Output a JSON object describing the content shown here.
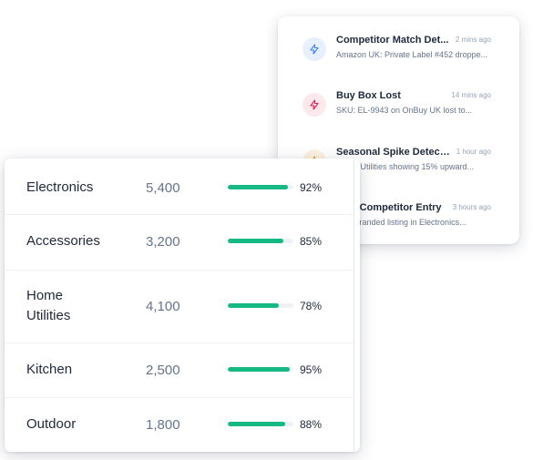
{
  "notifications": [
    {
      "title": "Competitor Match Det...",
      "time": "2 mins ago",
      "description": "Amazon UK: Private Label #452 droppe...",
      "icon": "lightning-icon",
      "color": "#3b82f6",
      "bg": "#e6f0fe"
    },
    {
      "title": "Buy Box Lost",
      "time": "14 mins ago",
      "description": "SKU: EL-9943 on OnBuy UK lost to...",
      "icon": "lightning-icon",
      "color": "#e11d48",
      "bg": "#fde8ec"
    },
    {
      "title": "Seasonal Spike Detected",
      "time": "1 hour ago",
      "description": "Home Utilities showing 15% upward...",
      "icon": "lightning-icon",
      "color": "#f59e0b",
      "bg": "#fdf2e1"
    },
    {
      "title": "New Competitor Entry",
      "time": "3 hours ago",
      "description": "New branded listing in Electronics...",
      "icon": "lightning-icon",
      "color": "#3b82f6",
      "bg": "#e6f0fe"
    }
  ],
  "categories": [
    {
      "name": "Electronics",
      "value": "5,400",
      "percent": "92%",
      "fraction": 0.92
    },
    {
      "name": "Accessories",
      "value": "3,200",
      "percent": "85%",
      "fraction": 0.85
    },
    {
      "name": "Home Utilities",
      "value": "4,100",
      "percent": "78%",
      "fraction": 0.78
    },
    {
      "name": "Kitchen",
      "value": "2,500",
      "percent": "95%",
      "fraction": 0.95
    },
    {
      "name": "Outdoor",
      "value": "1,800",
      "percent": "88%",
      "fraction": 0.88
    }
  ],
  "colors": {
    "bar": "#16b883"
  }
}
